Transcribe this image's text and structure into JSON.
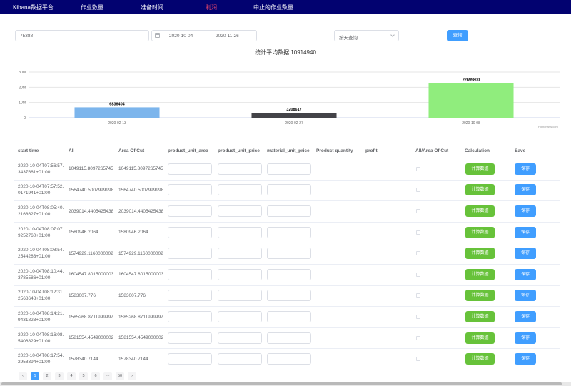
{
  "nav": {
    "brand": "Kibana数据平台",
    "items": [
      {
        "label": "作业数量",
        "active": false
      },
      {
        "label": "准备时间",
        "active": false
      },
      {
        "label": "利润",
        "active": true
      },
      {
        "label": "中止的作业数量",
        "active": false
      }
    ]
  },
  "filters": {
    "id_value": "75388",
    "date_start": "2020-10-04",
    "date_separator": "-",
    "date_end": "2020-11-26",
    "group_by": "按天查询",
    "query_label": "查询"
  },
  "stat_title": "统计平均数据:10914940",
  "chart_data": {
    "type": "bar",
    "categories": [
      "2020-02-13",
      "2020-02-27",
      "2020-10-08"
    ],
    "values": [
      6836404,
      3208617,
      22699800
    ],
    "data_labels": [
      "6836404",
      "3208617",
      "22699800"
    ],
    "colors": [
      "#7cb5ec",
      "#434348",
      "#90ed7d"
    ],
    "ylim": [
      0,
      30000000
    ],
    "yticks": [
      0,
      10000000,
      20000000,
      30000000
    ],
    "ytick_labels": [
      "0",
      "10M",
      "20M",
      "30M"
    ],
    "grid": true,
    "credit": "Highcharts.com"
  },
  "table": {
    "columns": [
      "start time",
      "All",
      "Area Of Cut",
      "product_unit_area",
      "product_unit_price",
      "material_unit_price",
      "Product quantity",
      "profit",
      "All/Area Of Cut",
      "Calculation",
      "Save"
    ],
    "calc_label": "计算数据",
    "save_label": "保存",
    "rows": [
      {
        "time_line1": "2020-10-04T07:56:57.",
        "time_line2": "3437661+01:00",
        "all": "1049115.8097265745",
        "area": "1049115.8097265745"
      },
      {
        "time_line1": "2020-10-04T07:57:52.",
        "time_line2": "0171941+01:00",
        "all": "1564740.5007999998",
        "area": "1564740.5007999998"
      },
      {
        "time_line1": "2020-10-04T08:05:40.",
        "time_line2": "2168627+01:00",
        "all": "2039014.4405425438",
        "area": "2039014.4405425438"
      },
      {
        "time_line1": "2020-10-04T08:07:07.",
        "time_line2": "9252760+01:00",
        "all": "1580946.2064",
        "area": "1580946.2064"
      },
      {
        "time_line1": "2020-10-04T08:08:54.",
        "time_line2": "2544283+01:00",
        "all": "1574929.1160000002",
        "area": "1574929.1160000002"
      },
      {
        "time_line1": "2020-10-04T08:10:44.",
        "time_line2": "3785586+01:00",
        "all": "1604547.8015000003",
        "area": "1604547.8015000003"
      },
      {
        "time_line1": "2020-10-04T08:12:31.",
        "time_line2": "2568648+01:00",
        "all": "1583007.776",
        "area": "1583007.776"
      },
      {
        "time_line1": "2020-10-04T08:14:21.",
        "time_line2": "9431823+01:00",
        "all": "1585268.8711999997",
        "area": "1585268.8711999997"
      },
      {
        "time_line1": "2020-10-04T08:16:08.",
        "time_line2": "5406829+01:00",
        "all": "1581554.4549000002",
        "area": "1581554.4549000002"
      },
      {
        "time_line1": "2020-10-04T08:17:54.",
        "time_line2": "2958394+01:00",
        "all": "1578340.7144",
        "area": "1578340.7144"
      }
    ]
  },
  "pagination": {
    "prev": "‹",
    "pages": [
      "1",
      "2",
      "3",
      "4",
      "5",
      "6"
    ],
    "ellipsis": "···",
    "last": "50",
    "next": "›",
    "current": "1"
  }
}
